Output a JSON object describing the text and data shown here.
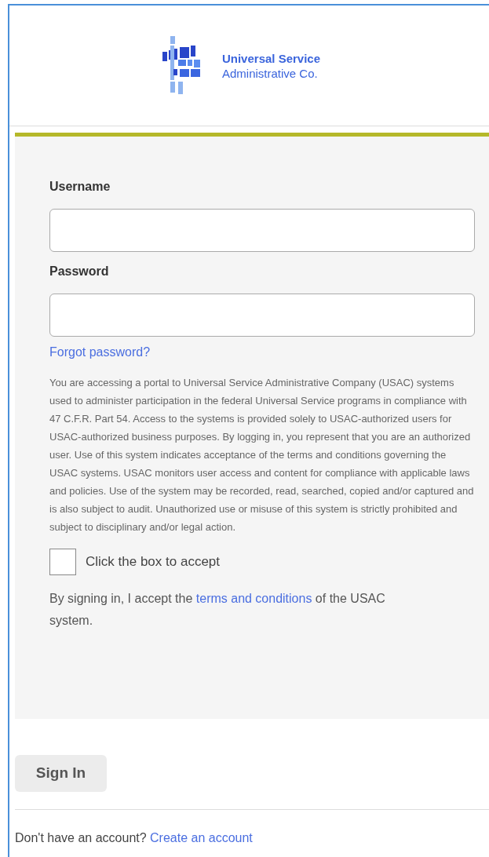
{
  "logo": {
    "line_1": "Universal Service",
    "line_2": "Administrative Co."
  },
  "form": {
    "fields": [
      {
        "label": "Username"
      },
      {
        "label": "Password"
      }
    ],
    "forgot_link": "Forgot password?",
    "notice": "You are accessing a portal to Universal Service Administrative Company (USAC) systems used to administer participation in the federal Universal Service programs in compliance with 47 C.F.R. Part 54. Access to the systems is provided solely to USAC-authorized users for USAC-authorized business purposes. By logging in, you represent that you are an authorized user. Use of this system indicates acceptance of the terms and conditions governing the USAC systems. USAC monitors user access and content for compliance with applicable laws and policies. Use of the system may be recorded, read, searched, copied and/or captured and is also subject to audit. Unauthorized use or misuse of this system is strictly prohibited and subject to disciplinary and/or legal action.",
    "accept": {
      "label": "Click the box to accept",
      "checked": false
    },
    "terms": {
      "before": "By signing in, I accept the ",
      "link": "terms and conditions",
      "after": " of the USAC system."
    }
  },
  "sign_in_button": "Sign In",
  "footer": {
    "text": "Don't have an account? ",
    "link": "Create an account"
  }
}
